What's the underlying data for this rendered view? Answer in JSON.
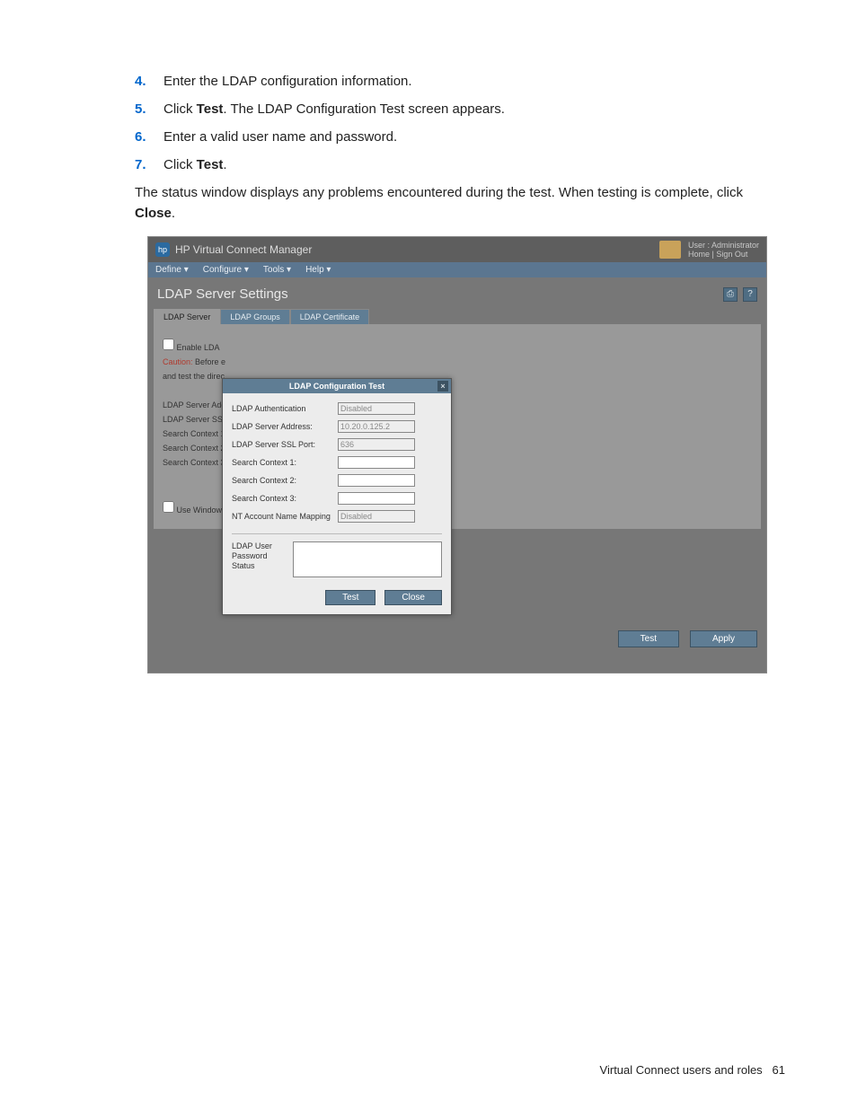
{
  "steps": [
    {
      "num": "4.",
      "text": "Enter the LDAP configuration information."
    },
    {
      "num": "5.",
      "prefix": "Click ",
      "bold": "Test",
      "suffix": ". The LDAP Configuration Test screen appears."
    },
    {
      "num": "6.",
      "text": "Enter a valid user name and password."
    },
    {
      "num": "7.",
      "prefix": "Click ",
      "bold": "Test",
      "suffix": "."
    }
  ],
  "body_text": {
    "prefix": "The status window displays any problems encountered during the test. When testing is complete, click ",
    "bold": "Close",
    "suffix": "."
  },
  "app": {
    "title": "HP Virtual Connect Manager",
    "logo_text": "hp",
    "user_line1": "User : Administrator",
    "user_line2_home": "Home",
    "user_line2_sep": " | ",
    "user_line2_signout": "Sign Out"
  },
  "menu": {
    "define": "Define",
    "configure": "Configure",
    "tools": "Tools",
    "help": "Help"
  },
  "page": {
    "title": "LDAP Server Settings",
    "help_icon": "?",
    "print_icon": "⎙"
  },
  "tabs": {
    "server": "LDAP Server",
    "groups": "LDAP Groups",
    "cert": "LDAP Certificate"
  },
  "bg_panel": {
    "enable": "Enable LDA",
    "caution_label": "Caution:",
    "caution_rest": " Before e",
    "caution_line2": "and test the direc",
    "addr": "LDAP Server Add",
    "ssl": "LDAP Server SSL",
    "sc1": "Search Context 1",
    "sc2": "Search Context 2",
    "sc3": "Search Context 3",
    "use_window": "Use Window"
  },
  "buttons": {
    "test": "Test",
    "apply": "Apply",
    "close": "Close"
  },
  "dialog": {
    "title": "LDAP Configuration Test",
    "close_x": "×",
    "fields": {
      "auth_label": "LDAP Authentication",
      "auth_value": "Disabled",
      "addr_label": "LDAP Server Address:",
      "addr_value": "10.20.0.125.2",
      "port_label": "LDAP Server SSL Port:",
      "port_value": "636",
      "sc1_label": "Search Context 1:",
      "sc1_value": "",
      "sc2_label": "Search Context 2:",
      "sc2_value": "",
      "sc3_label": "Search Context 3:",
      "sc3_value": "",
      "nt_label": "NT Account Name Mapping",
      "nt_value": "Disabled"
    },
    "status_label": "LDAP User Password Status"
  },
  "footer": {
    "section": "Virtual Connect users and roles",
    "page": "61"
  }
}
